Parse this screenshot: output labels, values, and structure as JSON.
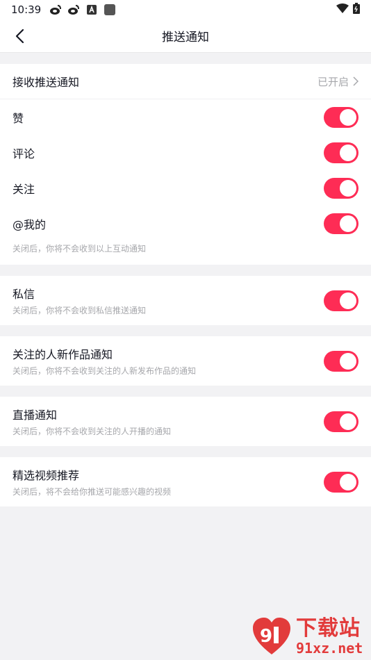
{
  "status_bar": {
    "time": "10:39"
  },
  "nav": {
    "title": "推送通知"
  },
  "push_section": {
    "receive": {
      "label": "接收推送通知",
      "value": "已开启"
    },
    "items": [
      {
        "label": "赞",
        "on": true
      },
      {
        "label": "评论",
        "on": true
      },
      {
        "label": "关注",
        "on": true
      },
      {
        "label": "@我的",
        "on": true
      }
    ],
    "hint": "关闭后，你将不会收到以上互动通知"
  },
  "settings": [
    {
      "label": "私信",
      "sub": "关闭后，你将不会收到私信推送通知",
      "on": true
    },
    {
      "label": "关注的人新作品通知",
      "sub": "关闭后，你将不会收到关注的人新发布作品的通知",
      "on": true
    },
    {
      "label": "直播通知",
      "sub": "关闭后，你将不会收到关注的人开播的通知",
      "on": true
    },
    {
      "label": "精选视频推荐",
      "sub": "关闭后，将不会给你推送可能感兴趣的视频",
      "on": true
    }
  ],
  "watermark": {
    "cn": "下载站",
    "en": "91xz.net"
  },
  "colors": {
    "accent": "#fe2c55",
    "background": "#f2f2f4"
  }
}
